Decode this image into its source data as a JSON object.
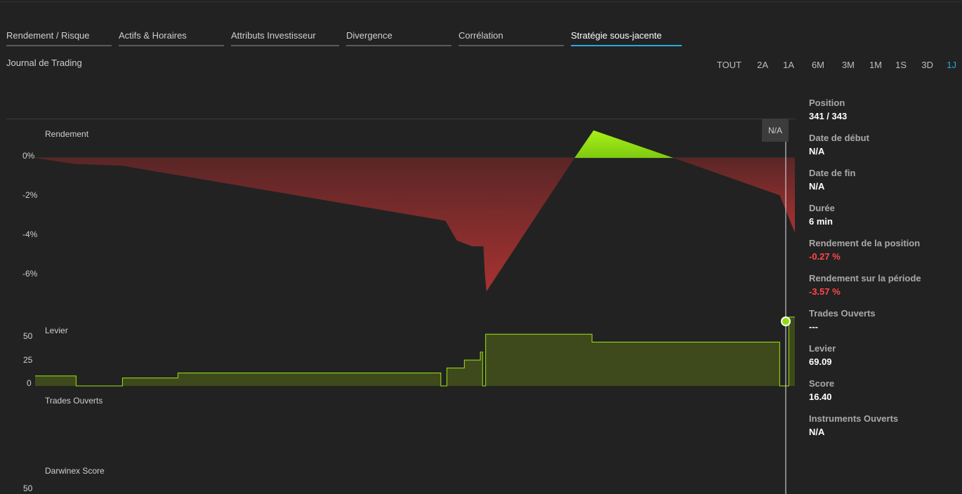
{
  "tabs": [
    {
      "label": "Rendement / Risque",
      "active": false
    },
    {
      "label": "Actifs & Horaires",
      "active": false
    },
    {
      "label": "Attributs Investisseur",
      "active": false
    },
    {
      "label": "Divergence",
      "active": false
    },
    {
      "label": "Corrélation",
      "active": false
    },
    {
      "label": "Stratégie sous-jacente",
      "active": true
    }
  ],
  "subtitle": "Journal de Trading",
  "periods": [
    {
      "label": "TOUT",
      "active": false
    },
    {
      "label": "2A",
      "active": false
    },
    {
      "label": "1A",
      "active": false
    },
    {
      "label": "6M",
      "active": false
    },
    {
      "label": "3M",
      "active": false
    },
    {
      "label": "1M",
      "active": false
    },
    {
      "label": "1S",
      "active": false
    },
    {
      "label": "3D",
      "active": false
    },
    {
      "label": "1J",
      "active": true
    }
  ],
  "colors": {
    "accent": "#29a8e0",
    "negative_area": "#8b2a2a",
    "positive_area": "#9ae60f",
    "leverage_line": "#9ae60f",
    "negative_text": "#ff4848"
  },
  "chart": {
    "cursor_tag": "N/A",
    "sections": {
      "rendement": "Rendement",
      "levier": "Levier",
      "trades": "Trades Ouverts",
      "score": "Darwinex Score"
    },
    "rendement_ticks": [
      "0%",
      "-2%",
      "-4%",
      "-6%"
    ],
    "levier_ticks": [
      "50",
      "25",
      "0"
    ],
    "score_ticks": [
      "50"
    ]
  },
  "chart_data": [
    {
      "type": "area",
      "title": "Rendement",
      "ylabel": "",
      "ylim": [
        -7,
        1.5
      ],
      "yticks": [
        0,
        -2,
        -4,
        -6
      ],
      "x": [
        0,
        0.05,
        0.115,
        0.54,
        0.555,
        0.575,
        0.59,
        0.592,
        0.594,
        0.71,
        0.735,
        0.84,
        0.98,
        1.0
      ],
      "values": [
        0,
        -0.3,
        -0.4,
        -3.2,
        -4.2,
        -4.5,
        -4.5,
        -5.9,
        -6.8,
        0,
        1.4,
        0,
        -1.9,
        -3.8
      ]
    },
    {
      "type": "area",
      "title": "Levier",
      "ylabel": "",
      "ylim": [
        0,
        65
      ],
      "yticks": [
        50,
        25,
        0
      ],
      "x": [
        0,
        0.054,
        0.054,
        0.115,
        0.115,
        0.188,
        0.188,
        0.534,
        0.534,
        0.542,
        0.542,
        0.565,
        0.565,
        0.586,
        0.586,
        0.589,
        0.589,
        0.593,
        0.593,
        0.733,
        0.733,
        0.98,
        0.98,
        0.992,
        0.992,
        1.0
      ],
      "values": [
        10,
        10,
        0,
        0,
        8,
        8,
        13,
        13,
        0,
        0,
        18,
        18,
        26,
        26,
        34,
        34,
        0,
        0,
        52,
        52,
        44,
        44,
        0,
        0,
        69.09,
        69.09
      ]
    }
  ],
  "panel": [
    {
      "label": "Position",
      "value": "341 / 343",
      "negative": false
    },
    {
      "label": "Date de début",
      "value": "N/A",
      "negative": false
    },
    {
      "label": "Date de fin",
      "value": "N/A",
      "negative": false
    },
    {
      "label": "Durée",
      "value": "6 min",
      "negative": false
    },
    {
      "label": "Rendement de la position",
      "value": "-0.27 %",
      "negative": true
    },
    {
      "label": "Rendement sur la période",
      "value": "-3.57 %",
      "negative": true
    },
    {
      "label": "Trades Ouverts",
      "value": "---",
      "negative": false
    },
    {
      "label": "Levier",
      "value": "69.09",
      "negative": false
    },
    {
      "label": "Score",
      "value": "16.40",
      "negative": false
    },
    {
      "label": "Instruments Ouverts",
      "value": "N/A",
      "negative": false
    }
  ]
}
